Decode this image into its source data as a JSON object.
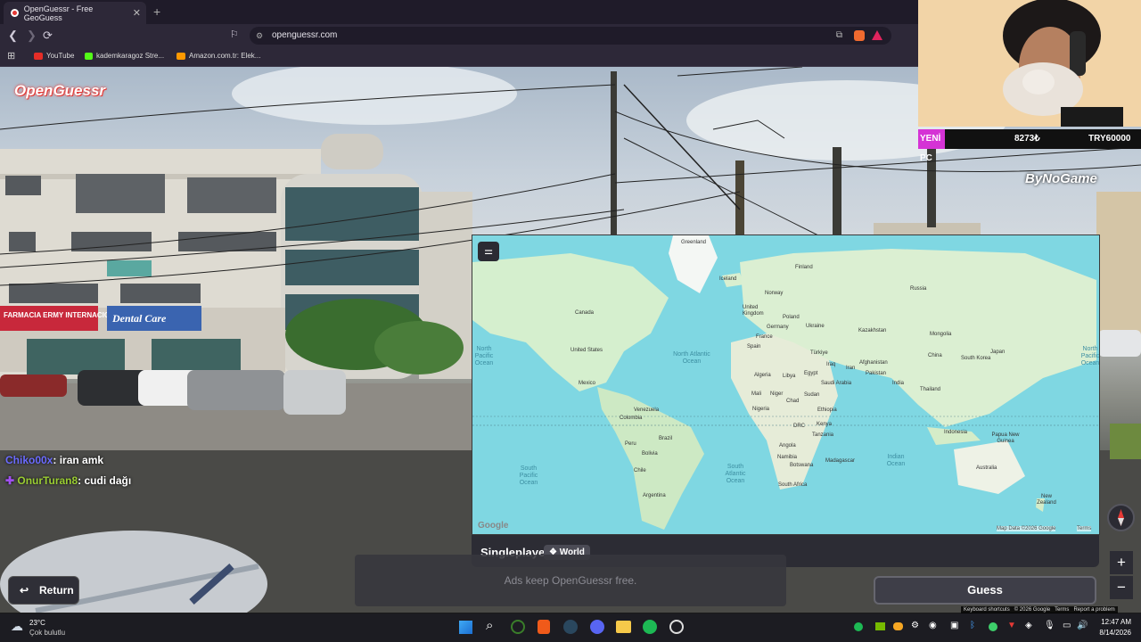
{
  "browser": {
    "tab_title": "OpenGuessr - Free GeoGuess",
    "url": "openguessr.com",
    "bookmarks": [
      "YouTube",
      "kademkaragoz Stre...",
      "Amazon.com.tr: Elek..."
    ]
  },
  "game": {
    "logo": "OpenGuessr",
    "mode_label": "Singleplayer",
    "map_label": "World",
    "ads_text": "Ads keep OpenGuessr free.",
    "return_label": "Return",
    "guess_label": "Guess",
    "zoom_in": "+",
    "zoom_out": "−"
  },
  "street_signs": {
    "pharmacy": "FARMACIA ERMY INTERNACIONAL",
    "dental": "Dental Care"
  },
  "map": {
    "watermark": "Google",
    "data_credit": "Map Data ©2026 Google",
    "terms": "Terms",
    "oceans": [
      "North Pacific Ocean",
      "North Atlantic Ocean",
      "South Pacific Ocean",
      "South Atlantic Ocean",
      "Indian Ocean",
      "North Pacific Ocean"
    ],
    "countries": [
      "Greenland",
      "Iceland",
      "Finland",
      "Norway",
      "Canada",
      "United Kingdom",
      "Poland",
      "Germany",
      "Ukraine",
      "Russia",
      "France",
      "Spain",
      "Kazakhstan",
      "Mongolia",
      "United States",
      "Türkiye",
      "Iraq",
      "Iran",
      "Afghanistan",
      "China",
      "South Korea",
      "Japan",
      "Mexico",
      "Algeria",
      "Libya",
      "Egypt",
      "Saudi Arabia",
      "Pakistan",
      "India",
      "Thailand",
      "Mali",
      "Niger",
      "Chad",
      "Sudan",
      "Ethiopia",
      "Nigeria",
      "Venezuela",
      "Colombia",
      "DRC",
      "Kenya",
      "Tanzania",
      "Indonesia",
      "Papua New Guinea",
      "Brazil",
      "Peru",
      "Bolivia",
      "Angola",
      "Namibia",
      "Botswana",
      "Madagascar",
      "Chile",
      "South Africa",
      "Australia",
      "Argentina",
      "New Zealand"
    ]
  },
  "chat": [
    {
      "user": "Chiko00x",
      "message": ": iran amk",
      "color": "#6b6bff"
    },
    {
      "user": "OnurTuran8",
      "message": ": cudi dağı",
      "color": "#9acd32"
    }
  ],
  "stream": {
    "badge": "YENİ PC",
    "count": "8273₺",
    "goal": "TRY60000",
    "sponsor": "ByNoGame"
  },
  "taskbar": {
    "temperature": "23°C",
    "weather": "Çok bulutlu",
    "time": "12:47 AM",
    "date": "8/14/2026"
  },
  "footer_credits": [
    "Keyboard shortcuts",
    "© 2026 Google",
    "Terms",
    "Report a problem"
  ]
}
